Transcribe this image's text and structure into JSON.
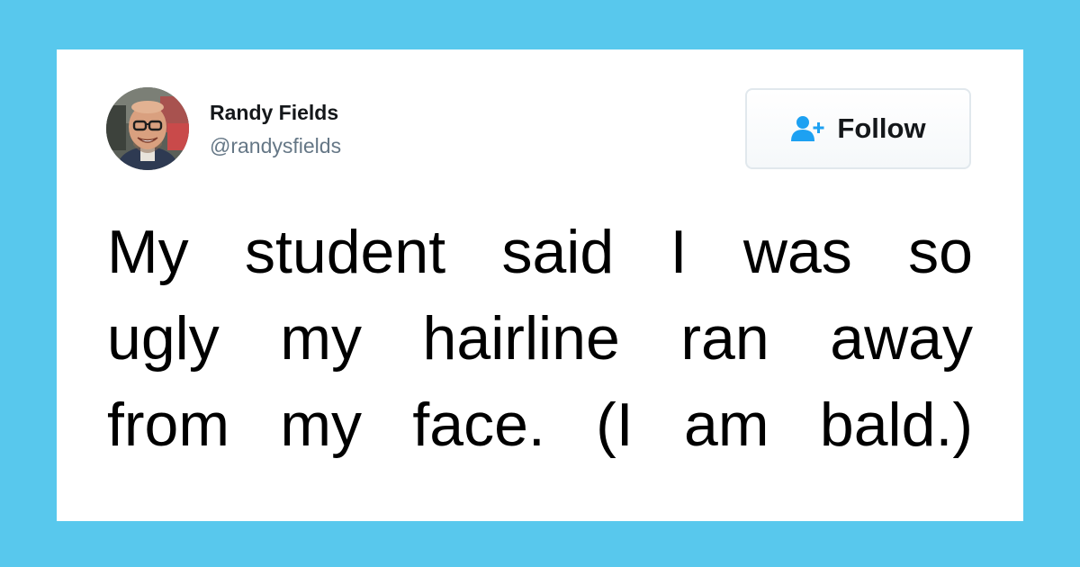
{
  "colors": {
    "background": "#58c8ed",
    "card": "#ffffff",
    "name_text": "#14171a",
    "handle_text": "#657786",
    "follow_icon": "#1da1f2",
    "tweet_text": "#000000"
  },
  "profile": {
    "name": "Randy Fields",
    "handle": "@randysfields",
    "avatar_icon": "profile-photo"
  },
  "follow_button": {
    "icon": "add-user-icon",
    "label": "Follow"
  },
  "tweet": {
    "lines": [
      "My student said I was so",
      "ugly my hairline ran away",
      "from my face. (I am bald.)"
    ]
  }
}
